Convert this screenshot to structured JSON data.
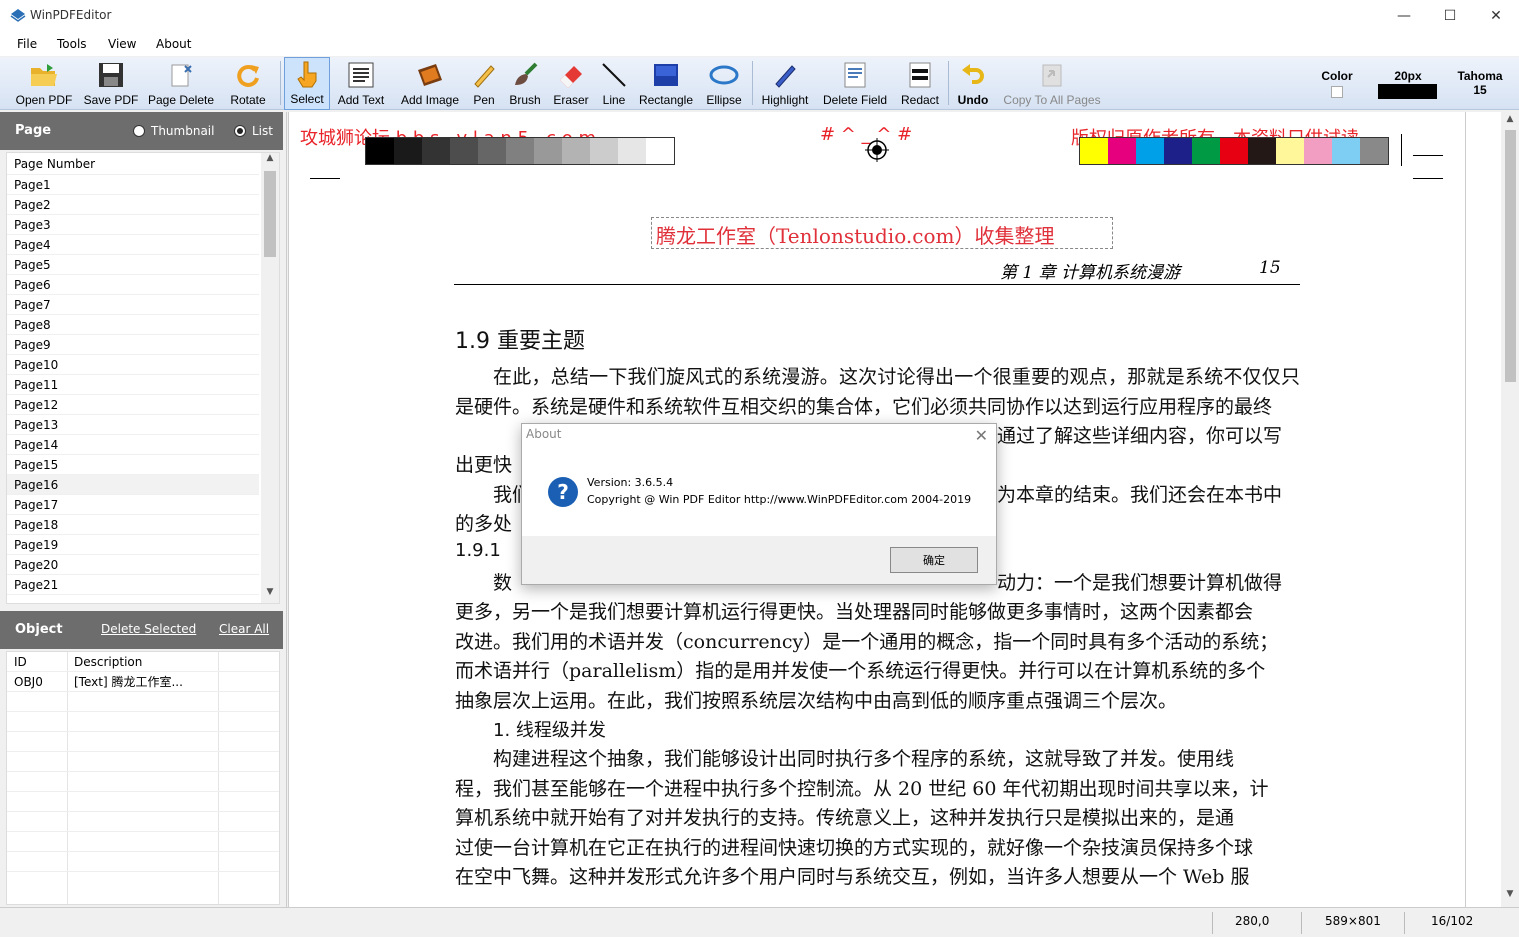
{
  "window": {
    "title": "WinPDFEditor"
  },
  "menu": [
    "File",
    "Tools",
    "View",
    "About"
  ],
  "toolbar": {
    "open_pdf": "Open PDF",
    "save_pdf": "Save PDF",
    "page_delete": "Page Delete",
    "rotate": "Rotate",
    "select": "Select",
    "add_text": "Add Text",
    "add_image": "Add Image",
    "pen": "Pen",
    "brush": "Brush",
    "eraser": "Eraser",
    "line": "Line",
    "rectangle": "Rectangle",
    "ellipse": "Ellipse",
    "highlight": "Highlight",
    "delete_field": "Delete Field",
    "redact": "Redact",
    "undo": "Undo",
    "copy_to_all": "Copy To All Pages"
  },
  "props": {
    "color_label": "Color",
    "size_label": "20px",
    "font_label": "Tahoma",
    "font_size": "15",
    "size_color": "#000000",
    "color_value": "#ffffff"
  },
  "page_panel": {
    "title": "Page",
    "thumbnail": "Thumbnail",
    "list": "List",
    "selected_view": "List",
    "column": "Page Number",
    "pages": [
      "Page1",
      "Page2",
      "Page3",
      "Page4",
      "Page5",
      "Page6",
      "Page7",
      "Page8",
      "Page9",
      "Page10",
      "Page11",
      "Page12",
      "Page13",
      "Page14",
      "Page15",
      "Page16",
      "Page17",
      "Page18",
      "Page19",
      "Page20",
      "Page21"
    ],
    "selected_page": "Page16"
  },
  "object_panel": {
    "title": "Object",
    "delete_selected": "Delete Selected",
    "clear_all": "Clear All",
    "col_id": "ID",
    "col_desc": "Description",
    "rows": [
      {
        "id": "OBJ0",
        "desc": "[Text] 腾龙工作室..."
      }
    ]
  },
  "document": {
    "watermark_left": "攻城狮论坛  b b s . v l a n 5 . c o m",
    "watermark_mid": "# ^ _ ^ #",
    "watermark_right": "版权归原作者所有，本资料只供试读",
    "stamp_text": "腾龙工作室（Tenlonstudio.com）收集整理",
    "running_header": "第 1 章   计算机系统漫游",
    "page_no": "15",
    "section": "1.9   重要主题",
    "para1": "在此，总结一下我们旋风式的系统漫游。这次讨论得出一个很重要的观点，那就是系统不仅仅只是硬件。系统是硬件和系统软件互相交织的集合体，它们必须共同协作以达到运行应用程序的最终",
    "para1_tail": "通过了解这些详细内容，你可以写",
    "para1_end": "出更快",
    "para2_start": "我们",
    "para2_tail": "为本章的结束。我们还会在本书中",
    "para2_end": "的多处",
    "subsection": "1.9.1",
    "para3_start": "数",
    "para3_tail": "动力：一个是我们想要计算机做得",
    "para3_lines": [
      "更多，另一个是我们想要计算机运行得更快。当处理器同时能够做更多事情时，这两个因素都会",
      "改进。我们用的术语并发（concurrency）是一个通用的概念，指一个同时具有多个活动的系统；",
      "而术语并行（parallelism）指的是用并发使一个系统运行得更快。并行可以在计算机系统的多个",
      "抽象层次上运用。在此，我们按照系统层次结构中由高到低的顺序重点强调三个层次。"
    ],
    "sub2": "1. 线程级并发",
    "para4_lines": [
      "构建进程这个抽象，我们能够设计出同时执行多个程序的系统，这就导致了并发。使用线",
      "程，我们甚至能够在一个进程中执行多个控制流。从 20 世纪 60 年代初期出现时间共享以来，计",
      "算机系统中就开始有了对并发执行的支持。传统意义上，这种并发执行只是模拟出来的，是通",
      "过使一台计算机在它正在执行的进程间快速切换的方式实现的，就好像一个杂技演员保持多个球",
      "在空中飞舞。这种并发形式允许多个用户同时与系统交互，例如，当许多人想要从一个 Web 服"
    ],
    "gray_swatches": [
      "#000000",
      "#1a1a1a",
      "#333333",
      "#4d4d4d",
      "#666666",
      "#808080",
      "#999999",
      "#b3b3b3",
      "#cccccc",
      "#e6e6e6",
      "#ffffff"
    ],
    "color_swatches": [
      "#ffff00",
      "#e6007e",
      "#00a0e9",
      "#1d2088",
      "#009944",
      "#e60012",
      "#231815",
      "#fff799",
      "#f19ec2",
      "#7ecef4",
      "#898989"
    ]
  },
  "about": {
    "title": "About",
    "version": "Version: 3.6.5.4",
    "copyright": "Copyright @ Win PDF Editor http://www.WinPDFEditor.com 2004-2019",
    "ok": "确定"
  },
  "status": {
    "coords": "280,0",
    "size": "589×801",
    "page": "16/102"
  }
}
